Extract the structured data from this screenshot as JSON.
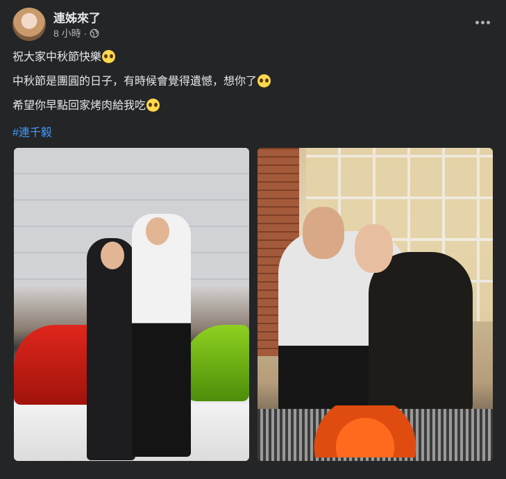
{
  "post": {
    "author": "連姊來了",
    "time": "8 小時",
    "separator": "·",
    "lines": [
      "祝大家中秋節快樂",
      "中秋節是團圓的日子，有時候會覺得遺憾，想你了",
      "希望你早點回家烤肉給我吃"
    ],
    "hashtag": "#連千毅",
    "icons": {
      "privacy": "globe-icon",
      "menu": "more-options-icon",
      "emoji1": "kissing-face-emoji",
      "emoji2": "pleading-face-emoji",
      "emoji3": "pleading-face-emoji"
    },
    "colors": {
      "background": "#242526",
      "text": "#e4e6eb",
      "secondary": "#b0b3b8",
      "hashtag": "#4599ff"
    }
  }
}
